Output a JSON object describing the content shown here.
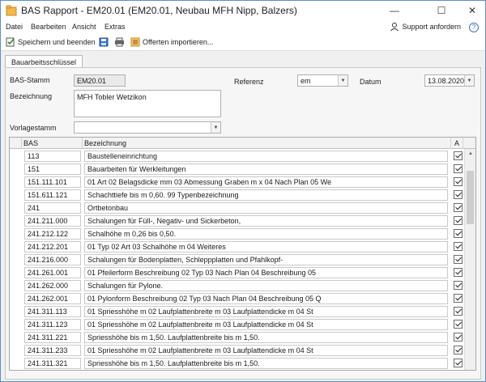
{
  "window": {
    "title": "BAS Rapport - EM20.01 (EM20.01, Neubau MFH Nipp, Balzers)",
    "minimize": "—",
    "maximize": "☐",
    "close": "✕"
  },
  "menu": {
    "items": [
      "Datei",
      "Bearbeiten",
      "Ansicht",
      "Extras"
    ],
    "support": "Support anfordern",
    "help": "?"
  },
  "toolbar": {
    "save_close": "Speichern und beenden",
    "import": "Offerten importieren..."
  },
  "tab": {
    "label": "Bauarbeitsschlüssel"
  },
  "form": {
    "bas_stamm_label": "BAS-Stamm",
    "bas_stamm_value": "EM20.01",
    "referenz_label": "Referenz",
    "referenz_value": "em",
    "datum_label": "Datum",
    "datum_value": "13.08.2020",
    "bezeichnung_label": "Bezeichnung",
    "bezeichnung_value": "MFH Tobler Wetzikon",
    "vorlagestamm_label": "Vorlagestamm",
    "vorlagestamm_value": ""
  },
  "grid": {
    "headers": {
      "bas": "BAS",
      "bezeichnung": "Bezeichnung",
      "a": "A"
    },
    "rows": [
      {
        "bas": "113",
        "bez": "Baustelleneinrichtung"
      },
      {
        "bas": "151",
        "bez": "Bauarbeiten für Werkleitungen"
      },
      {
        "bas": "151.111.101",
        "bez": "01 Art  02 Belagsdicke mm  03 Abmessung Graben m x 04 Nach Plan  05 We"
      },
      {
        "bas": "151.611.121",
        "bez": "Schachttiefe bis m 0,60. 99 Typenbezeichnung"
      },
      {
        "bas": "241",
        "bez": "Ortbetonbau"
      },
      {
        "bas": "241.211.000",
        "bez": "Schalungen für Füll-, Negativ- und Sickerbeton,"
      },
      {
        "bas": "241.212.122",
        "bez": "Schalhöhe m 0,26 bis 0,50."
      },
      {
        "bas": "241.212.201",
        "bez": "01 Typ  02 Art  03 Schalhöhe m  04 Weiteres"
      },
      {
        "bas": "241.216.000",
        "bez": "Schalungen für Bodenplatten, Schleppplatten und Pfahlkopf-"
      },
      {
        "bas": "241.261.001",
        "bez": "01 Pfeilerform Beschreibung  02 Typ  03 Nach Plan  04 Beschreibung  05"
      },
      {
        "bas": "241.262.000",
        "bez": "Schalungen für Pylone."
      },
      {
        "bas": "241.262.001",
        "bez": "01 Pylonform Beschreibung  02 Typ  03 Nach Plan  04 Beschreibung  05 Q"
      },
      {
        "bas": "241.311.113",
        "bez": "01 Spriesshöhe m  02 Laufplattenbreite m  03 Laufplattendicke m  04 St"
      },
      {
        "bas": "241.311.123",
        "bez": "01 Spriesshöhe m  02 Laufplattenbreite m  03 Laufplattendicke m  04 St"
      },
      {
        "bas": "241.311.221",
        "bez": "Spriesshöhe bis m 1,50. Laufplattenbreite bis m 1,50."
      },
      {
        "bas": "241.311.233",
        "bez": "01 Spriesshöhe m  02 Laufplattenbreite m  03 Laufplattendicke m  04 St"
      },
      {
        "bas": "241.311.321",
        "bez": "Spriesshöhe bis m 1,50. Laufplattenbreite bis m 1,50."
      },
      {
        "bas": "241.400.000",
        "bez": "Aussparungen und Einlagen"
      }
    ]
  }
}
